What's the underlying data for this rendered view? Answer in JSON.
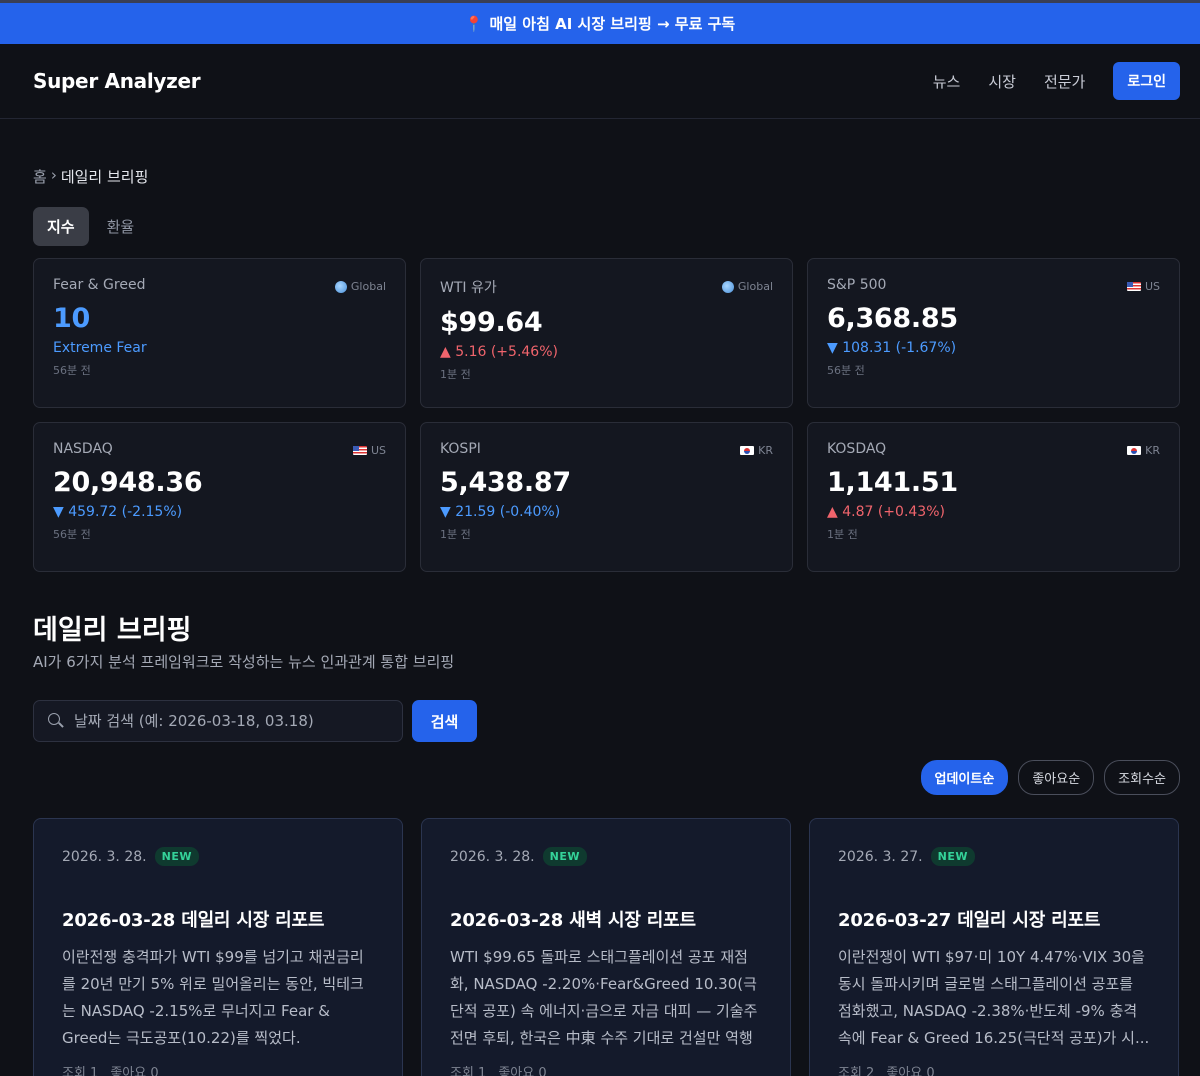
{
  "promo": {
    "icon": "pin-icon",
    "text": "매일 아침 AI 시장 브리핑 → 무료 구독"
  },
  "nav": {
    "brand": "Super Analyzer",
    "links": [
      "뉴스",
      "시장",
      "전문가"
    ],
    "login": "로그인"
  },
  "breadcrumb": {
    "home": "홈",
    "separator": "›",
    "current": "데일리 브리핑"
  },
  "tabs": [
    {
      "label": "지수",
      "active": true
    },
    {
      "label": "환율",
      "active": false
    }
  ],
  "markets": [
    {
      "label": "Fear & Greed",
      "region": "Global",
      "value": "10",
      "change": "Extreme Fear",
      "direction": "sentiment",
      "time": "56분 전"
    },
    {
      "label": "WTI 유가",
      "region": "Global",
      "value": "$99.64",
      "change": "▲ 5.16 (+5.46%)",
      "direction": "up",
      "time": "1분 전"
    },
    {
      "label": "S&P 500",
      "region": "US",
      "value": "6,368.85",
      "change": "▼ 108.31 (-1.67%)",
      "direction": "down",
      "time": "56분 전"
    },
    {
      "label": "NASDAQ",
      "region": "US",
      "value": "20,948.36",
      "change": "▼ 459.72 (-2.15%)",
      "direction": "down",
      "time": "56분 전"
    },
    {
      "label": "KOSPI",
      "region": "KR",
      "value": "5,438.87",
      "change": "▼ 21.59 (-0.40%)",
      "direction": "down",
      "time": "1분 전"
    },
    {
      "label": "KOSDAQ",
      "region": "KR",
      "value": "1,141.51",
      "change": "▲ 4.87 (+0.43%)",
      "direction": "up",
      "time": "1분 전"
    }
  ],
  "section": {
    "title": "데일리 브리핑",
    "subtitle": "AI가 6가지 분석 프레임워크로 작성하는 뉴스 인과관계 통합 브리핑"
  },
  "search": {
    "placeholder": "날짜 검색 (예: 2026-03-18, 03.18)",
    "button": "검색"
  },
  "sort": [
    {
      "label": "업데이트순",
      "active": true
    },
    {
      "label": "좋아요순",
      "active": false
    },
    {
      "label": "조회수순",
      "active": false
    }
  ],
  "reports": [
    {
      "date": "2026. 3. 28.",
      "badge": "NEW",
      "title": "2026-03-28 데일리 시장 리포트",
      "summary": "이란전쟁 충격파가 WTI $99를 넘기고 채권금리를 20년 만기 5% 위로 밀어올리는 동안, 빅테크는 NASDAQ -2.15%로 무너지고 Fear & Greed는 극도공포(10.22)를 찍었다.",
      "views": "조회 1",
      "likes": "좋아요 0"
    },
    {
      "date": "2026. 3. 28.",
      "badge": "NEW",
      "title": "2026-03-28 새벽 시장 리포트",
      "summary": "WTI $99.65 돌파로 스태그플레이션 공포 재점화, NASDAQ -2.20%·Fear&Greed 10.30(극단적 공포) 속 에너지·금으로 자금 대피 — 기술주 전면 후퇴, 한국은 中東 수주 기대로 건설만 역행",
      "views": "조회 1",
      "likes": "좋아요 0"
    },
    {
      "date": "2026. 3. 27.",
      "badge": "NEW",
      "title": "2026-03-27 데일리 시장 리포트",
      "summary": "이란전쟁이 WTI $97·미 10Y 4.47%·VIX 30을 동시 돌파시키며 글로벌 스태그플레이션 공포를 점화했고, NASDAQ -2.38%·반도체 -9% 충격 속에 Fear & Greed 16.25(극단적 공포)가 시...",
      "views": "조회 2",
      "likes": "좋아요 0"
    }
  ],
  "colors": {
    "accent": "#2563eb",
    "up": "#f0646c",
    "down": "#4c9bff",
    "new_badge": "#34d399"
  }
}
